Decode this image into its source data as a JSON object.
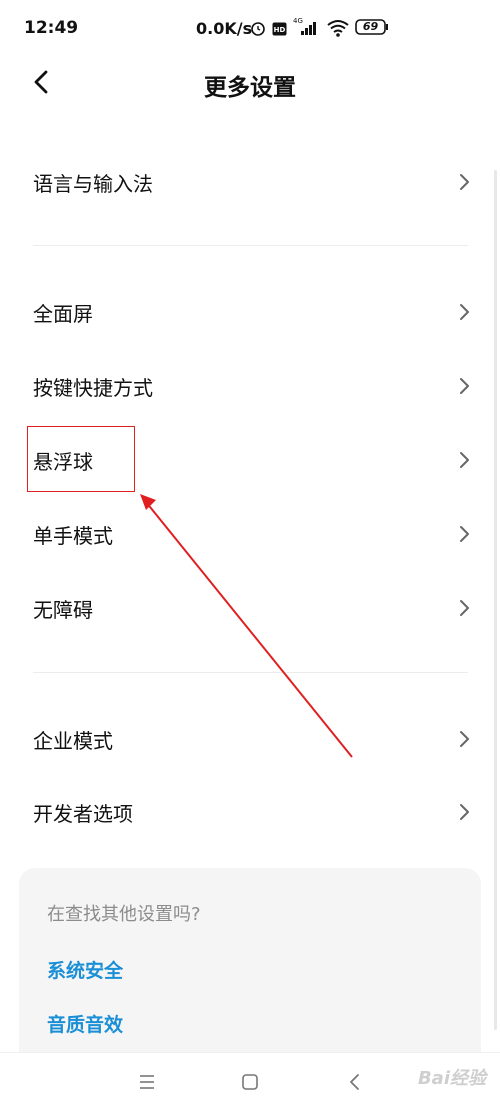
{
  "status_bar": {
    "time": "12:49",
    "net_speed": "0.0K/s",
    "network_type": "4G",
    "battery": "69",
    "icons": [
      "alarm-icon",
      "hd-icon",
      "signal-icon",
      "wifi-icon",
      "battery-icon"
    ]
  },
  "header": {
    "back_icon": "chevron-left-icon",
    "title": "更多设置"
  },
  "sections": [
    {
      "items": [
        {
          "label": "语言与输入法"
        }
      ]
    },
    {
      "items": [
        {
          "label": "全面屏"
        },
        {
          "label": "按键快捷方式"
        },
        {
          "label": "悬浮球"
        },
        {
          "label": "单手模式"
        },
        {
          "label": "无障碍"
        }
      ]
    },
    {
      "items": [
        {
          "label": "企业模式"
        },
        {
          "label": "开发者选项"
        }
      ]
    }
  ],
  "suggestions": {
    "title": "在查找其他设置吗?",
    "links": [
      "系统安全",
      "音质音效"
    ]
  },
  "nav_bar": {
    "icons": [
      "menu-icon",
      "home-icon",
      "back-icon"
    ]
  },
  "watermark": "Bai经验",
  "colors": {
    "link": "#1a8fd6",
    "annotation": "#e02020",
    "card_bg": "#f5f5f5"
  }
}
